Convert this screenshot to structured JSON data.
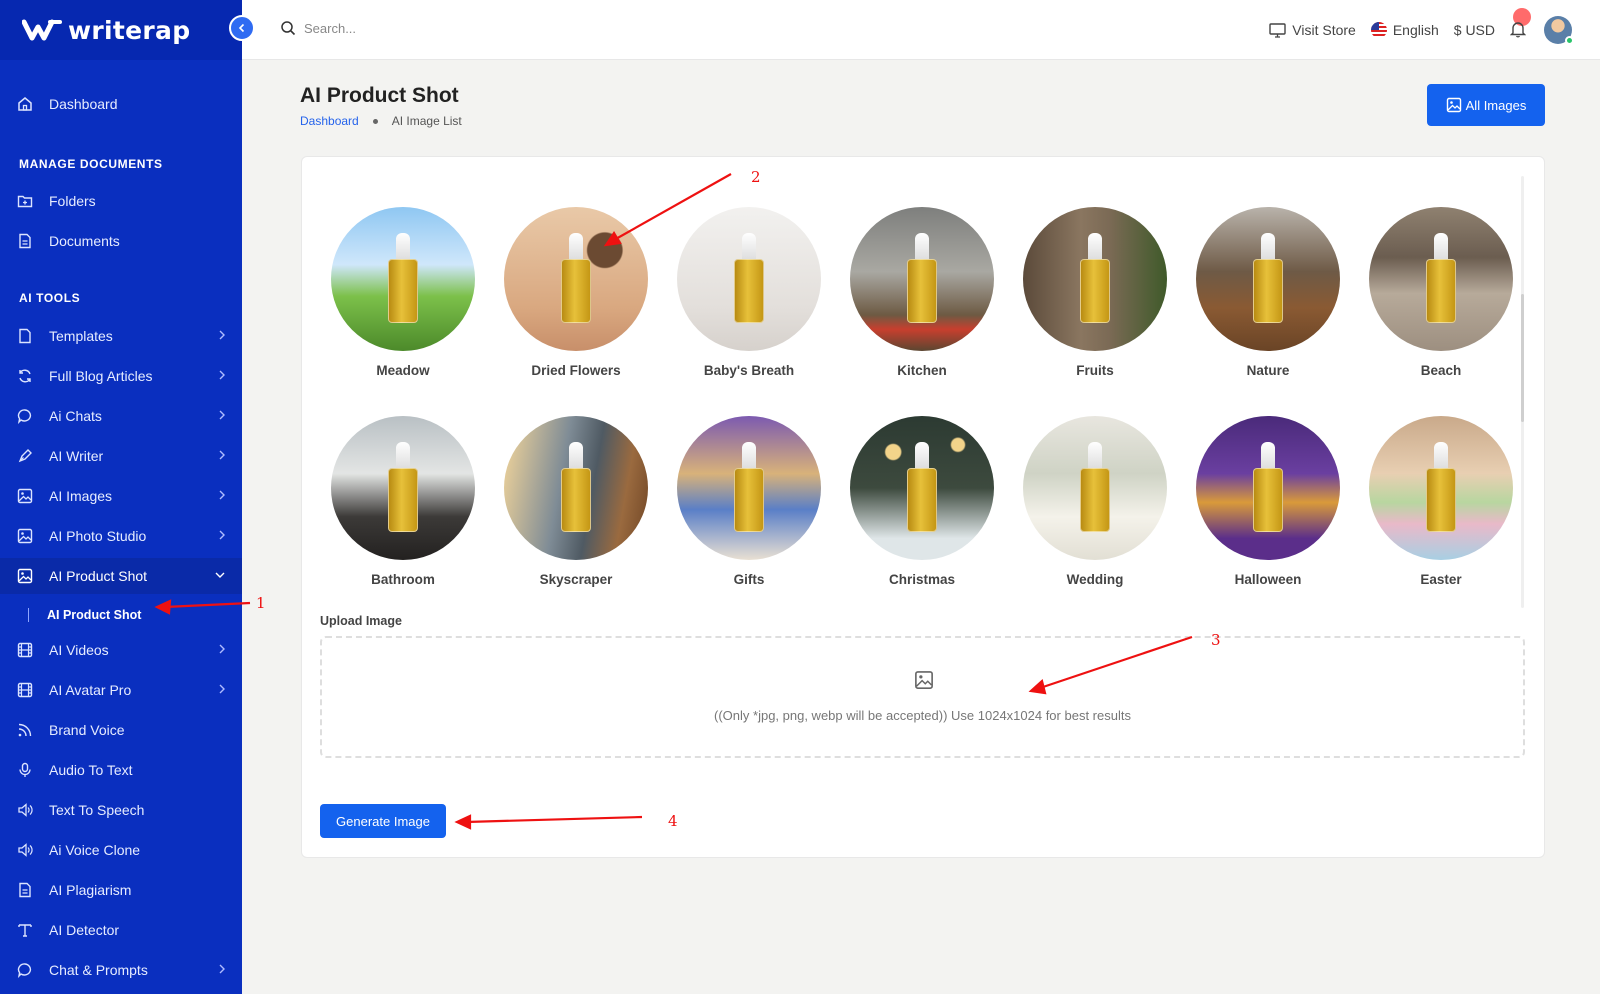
{
  "brand": {
    "name": "writerap"
  },
  "sidebar": {
    "items": [
      {
        "label": "Dashboard",
        "icon": "home-icon"
      },
      {
        "label": "Folders",
        "icon": "folder-icon"
      },
      {
        "label": "Documents",
        "icon": "document-icon"
      },
      {
        "label": "Templates",
        "icon": "file-icon"
      },
      {
        "label": "Full Blog Articles",
        "icon": "refresh-icon"
      },
      {
        "label": "Ai Chats",
        "icon": "chat-icon"
      },
      {
        "label": "AI Writer",
        "icon": "pen-icon"
      },
      {
        "label": "AI Images",
        "icon": "image-icon"
      },
      {
        "label": "AI Photo Studio",
        "icon": "image-icon"
      },
      {
        "label": "AI Product Shot",
        "icon": "image-icon"
      },
      {
        "label": "AI Videos",
        "icon": "film-icon"
      },
      {
        "label": "AI Avatar Pro",
        "icon": "film-icon"
      },
      {
        "label": "Brand Voice",
        "icon": "rss-icon"
      },
      {
        "label": "Audio To Text",
        "icon": "mic-icon"
      },
      {
        "label": "Text To Speech",
        "icon": "speaker-icon"
      },
      {
        "label": "Ai Voice Clone",
        "icon": "speaker-icon"
      },
      {
        "label": "AI Plagiarism",
        "icon": "document-icon"
      },
      {
        "label": "AI Detector",
        "icon": "type-icon"
      },
      {
        "label": "Chat & Prompts",
        "icon": "chat-icon"
      }
    ],
    "sections": {
      "manage": "MANAGE DOCUMENTS",
      "tools": "AI TOOLS"
    },
    "sub_item": "AI Product Shot"
  },
  "header": {
    "search_placeholder": "Search...",
    "visit_store": "Visit Store",
    "language": "English",
    "currency": "$ USD"
  },
  "page": {
    "title": "AI Product Shot",
    "breadcrumb": [
      "Dashboard",
      "AI Image List"
    ],
    "all_images_button": "All Images"
  },
  "styles": [
    "Meadow",
    "Dried Flowers",
    "Baby's Breath",
    "Kitchen",
    "Fruits",
    "Nature",
    "Beach",
    "Bathroom",
    "Skyscraper",
    "Gifts",
    "Christmas",
    "Wedding",
    "Halloween",
    "Easter"
  ],
  "upload": {
    "label": "Upload Image",
    "hint": "((Only *jpg, png, webp will be accepted)) Use 1024x1024 for best results"
  },
  "generate_button": "Generate Image",
  "annotations": [
    "1",
    "2",
    "3",
    "4"
  ],
  "colors": {
    "sidebar": "#0a2fbf",
    "primary": "#1462ee",
    "annotation": "#e11111"
  }
}
